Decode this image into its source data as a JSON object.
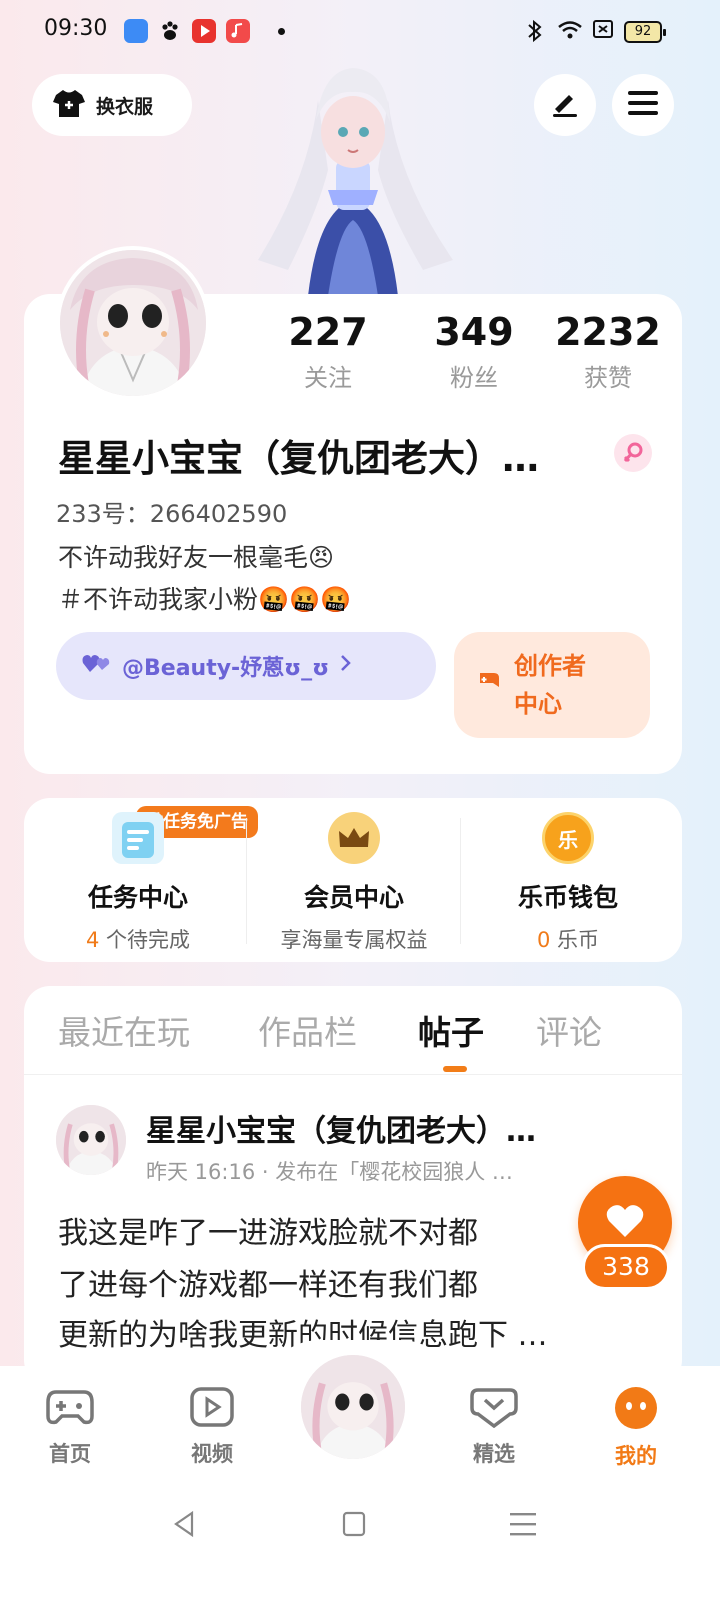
{
  "status_bar": {
    "time": "09:30",
    "battery": "92",
    "apps": [
      "blue-app",
      "baidu-paw",
      "red-play",
      "red-music"
    ],
    "icons": [
      "bluetooth-icon",
      "wifi-icon",
      "sim-icon"
    ]
  },
  "top": {
    "outfit_label": "换衣服"
  },
  "profile": {
    "stats": [
      {
        "value": "227",
        "label": "关注"
      },
      {
        "value": "349",
        "label": "粉丝"
      },
      {
        "value": "2232",
        "label": "获赞"
      }
    ],
    "nickname": "星星小宝宝（复仇团老大）…",
    "uid": "233号：266402590",
    "bio_line1": "不许动我好友一根毫毛😠",
    "bio_line2": "＃不许动我家小粉🤬🤬🤬",
    "link_label": "@Beauty-妤蒽ʊ_ʊ",
    "creator_label_1": "创作者",
    "creator_label_2": "中心"
  },
  "services": {
    "task_badge": "做任务免广告",
    "items": [
      {
        "title": "任务中心",
        "sub_hl": "4",
        "sub": " 个待完成"
      },
      {
        "title": "会员中心",
        "sub_hl": "",
        "sub": "享海量专属权益"
      },
      {
        "title": "乐币钱包",
        "sub_hl": "0",
        "sub": " 乐币"
      }
    ],
    "wallet_coin": "乐"
  },
  "tabs": [
    "最近在玩",
    "作品栏",
    "帖子",
    "评论"
  ],
  "post": {
    "author": "星星小宝宝（复仇团老大）…",
    "meta": "昨天 16:16 · 发布在「樱花校园狼人 …",
    "line1": "我这是咋了一进游戏脸就不对都",
    "line2": "了进每个游戏都一样还有我们都",
    "line3": "更新的为啥我更新的时候信息跑下 …",
    "likes": "338"
  },
  "nav": [
    {
      "label": "首页",
      "icon": "gamepad-icon"
    },
    {
      "label": "视频",
      "icon": "video-icon"
    },
    {
      "label": "精选",
      "icon": "heart-chat-icon"
    },
    {
      "label": "我的",
      "icon": "profile-face-icon"
    }
  ],
  "colors": {
    "accent": "#f27a16",
    "link": "#6b63d6"
  }
}
